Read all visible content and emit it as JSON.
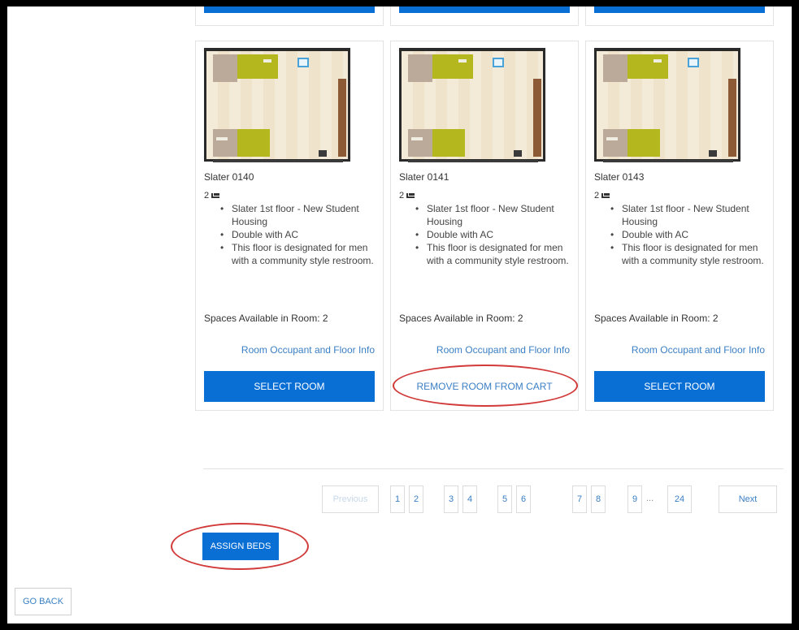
{
  "rooms": [
    {
      "name": "Slater 0140",
      "beds": "2",
      "features": [
        "Slater 1st floor - New Student Housing",
        "Double with AC",
        "This floor is designated for men with a community style restroom."
      ],
      "spaces": "Spaces Available in Room: 2",
      "occupant_link": "Room Occupant and Floor Info",
      "action_label": "SELECT ROOM"
    },
    {
      "name": "Slater 0141",
      "beds": "2",
      "features": [
        "Slater 1st floor - New Student Housing",
        "Double with AC",
        "This floor is designated for men with a community style restroom."
      ],
      "spaces": "Spaces Available in Room: 2",
      "occupant_link": "Room Occupant and Floor Info",
      "action_label": "REMOVE ROOM FROM CART"
    },
    {
      "name": "Slater 0143",
      "beds": "2",
      "features": [
        "Slater 1st floor - New Student Housing",
        "Double with AC",
        "This floor is designated for men with a community style restroom."
      ],
      "spaces": "Spaces Available in Room: 2",
      "occupant_link": "Room Occupant and Floor Info",
      "action_label": "SELECT ROOM"
    }
  ],
  "pagination": {
    "previous": "Previous",
    "pages": [
      "1",
      "2",
      "3",
      "4",
      "5",
      "6",
      "7",
      "8",
      "9"
    ],
    "ellipsis": "...",
    "last": "24",
    "next": "Next"
  },
  "assign_beds_label": "ASSIGN BEDS",
  "go_back_label": "GO BACK",
  "colors": {
    "primary": "#0a6fd4",
    "link": "#3a7fc4",
    "highlight_annotation": "#d23a3a"
  }
}
